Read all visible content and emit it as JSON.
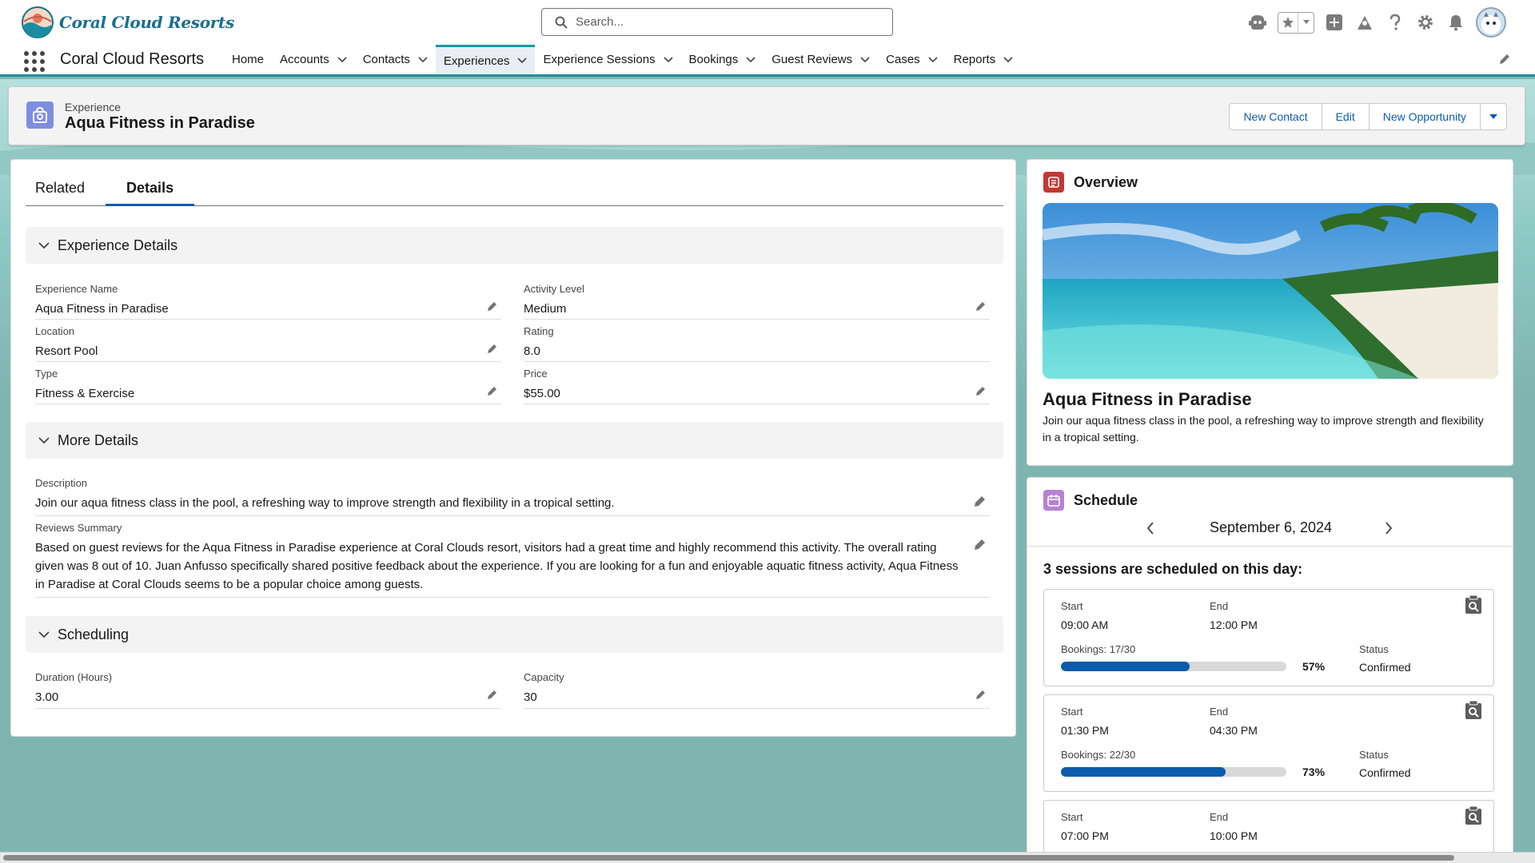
{
  "header": {
    "logo_text": "Coral Cloud Resorts",
    "search_placeholder": "Search..."
  },
  "nav": {
    "app_name": "Coral Cloud Resorts",
    "items": [
      {
        "label": "Home",
        "has_menu": false
      },
      {
        "label": "Accounts",
        "has_menu": true
      },
      {
        "label": "Contacts",
        "has_menu": true
      },
      {
        "label": "Experiences",
        "has_menu": true,
        "active": true
      },
      {
        "label": "Experience Sessions",
        "has_menu": true
      },
      {
        "label": "Bookings",
        "has_menu": true
      },
      {
        "label": "Guest Reviews",
        "has_menu": true
      },
      {
        "label": "Cases",
        "has_menu": true
      },
      {
        "label": "Reports",
        "has_menu": true
      }
    ]
  },
  "record": {
    "type": "Experience",
    "title": "Aqua Fitness in Paradise",
    "actions": [
      "New Contact",
      "Edit",
      "New Opportunity"
    ]
  },
  "tabs": [
    "Related",
    "Details"
  ],
  "sections": {
    "experience_details": "Experience Details",
    "more_details": "More Details",
    "scheduling": "Scheduling"
  },
  "fields": {
    "experience_name": {
      "label": "Experience Name",
      "value": "Aqua Fitness in Paradise"
    },
    "activity_level": {
      "label": "Activity Level",
      "value": "Medium"
    },
    "location": {
      "label": "Location",
      "value": "Resort Pool"
    },
    "rating": {
      "label": "Rating",
      "value": "8.0"
    },
    "type": {
      "label": "Type",
      "value": "Fitness & Exercise"
    },
    "price": {
      "label": "Price",
      "value": "$55.00"
    },
    "description": {
      "label": "Description",
      "value": "Join our aqua fitness class in the pool, a refreshing way to improve strength and flexibility in a tropical setting."
    },
    "reviews_summary": {
      "label": "Reviews Summary",
      "value": "Based on guest reviews for the Aqua Fitness in Paradise experience at Coral Clouds resort, visitors had a great time and highly recommend this activity. The overall rating given was 8 out of 10. Juan Anfusso specifically shared positive feedback about the experience. If you are looking for a fun and enjoyable aquatic fitness activity, Aqua Fitness in Paradise at Coral Clouds seems to be a popular choice among guests."
    },
    "duration": {
      "label": "Duration (Hours)",
      "value": "3.00"
    },
    "capacity": {
      "label": "Capacity",
      "value": "30"
    }
  },
  "overview": {
    "title": "Overview",
    "name": "Aqua Fitness in Paradise",
    "description": "Join our aqua fitness class in the pool, a refreshing way to improve strength and flexibility in a tropical setting."
  },
  "schedule": {
    "title": "Schedule",
    "date": "September 6, 2024",
    "sessions_heading": "3 sessions are scheduled on this day:",
    "labels": {
      "start": "Start",
      "end": "End",
      "status": "Status"
    },
    "sessions": [
      {
        "start": "09:00 AM",
        "end": "12:00 PM",
        "bookings": "Bookings: 17/30",
        "percent": 57,
        "percent_label": "57%",
        "status": "Confirmed"
      },
      {
        "start": "01:30 PM",
        "end": "04:30 PM",
        "bookings": "Bookings: 22/30",
        "percent": 73,
        "percent_label": "73%",
        "status": "Confirmed"
      },
      {
        "start": "07:00 PM",
        "end": "10:00 PM"
      }
    ]
  },
  "colors": {
    "brand_blue": "#0b5cab",
    "nav_accent": "#1b96a5",
    "experience_icon": "#7f8de1",
    "overview_icon": "#c23934",
    "schedule_icon": "#b781d3"
  }
}
